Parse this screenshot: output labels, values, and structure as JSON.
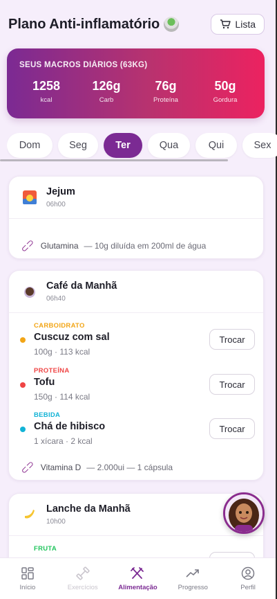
{
  "header": {
    "title": "Plano Anti-inflamatório",
    "list_label": "Lista"
  },
  "macros": {
    "title": "SEUS MACROS DIÁRIOS (63KG)",
    "items": [
      {
        "value": "1258",
        "label": "kcal"
      },
      {
        "value": "126g",
        "label": "Carb"
      },
      {
        "value": "76g",
        "label": "Proteína"
      },
      {
        "value": "50g",
        "label": "Gordura"
      }
    ]
  },
  "days": [
    {
      "label": "Dom",
      "active": false
    },
    {
      "label": "Seg",
      "active": false
    },
    {
      "label": "Ter",
      "active": true
    },
    {
      "label": "Qua",
      "active": false
    },
    {
      "label": "Qui",
      "active": false
    },
    {
      "label": "Sex",
      "active": false
    }
  ],
  "meals": [
    {
      "name": "Jejum",
      "time": "06h00",
      "icon": "sunrise-icon",
      "supplement": {
        "name": "Glutamina",
        "detail": "— 10g diluída em 200ml de água"
      }
    },
    {
      "name": "Café da Manhã",
      "time": "06h40",
      "icon": "coffee-cup-icon",
      "foods": [
        {
          "category": "CARBOIDRATO",
          "name": "Cuscuz com sal",
          "detail": "100g · 113 kcal",
          "color": "#f2a516"
        },
        {
          "category": "PROTEÍNA",
          "name": "Tofu",
          "detail": "150g · 114 kcal",
          "color": "#ef4444"
        },
        {
          "category": "BEBIDA",
          "name": "Chá de hibisco",
          "detail": "1 xícara · 2 kcal",
          "color": "#12b3d6"
        }
      ],
      "swap_label": "Trocar",
      "supplement": {
        "name": "Vitamina D",
        "detail": "— 2.000ui — 1 cápsula"
      }
    },
    {
      "name": "Lanche da Manhã",
      "time": "10h00",
      "icon": "banana-icon",
      "foods": [
        {
          "category": "FRUTA",
          "color": "#22c55e"
        }
      ]
    }
  ],
  "nav": [
    {
      "label": "Início",
      "icon": "grid-icon",
      "state": "normal"
    },
    {
      "label": "Exercícios",
      "icon": "dumbbell-icon",
      "state": "disabled"
    },
    {
      "label": "Alimentação",
      "icon": "utensils-icon",
      "state": "active"
    },
    {
      "label": "Progresso",
      "icon": "trend-up-icon",
      "state": "normal"
    },
    {
      "label": "Perfil",
      "icon": "user-circle-icon",
      "state": "normal"
    }
  ]
}
